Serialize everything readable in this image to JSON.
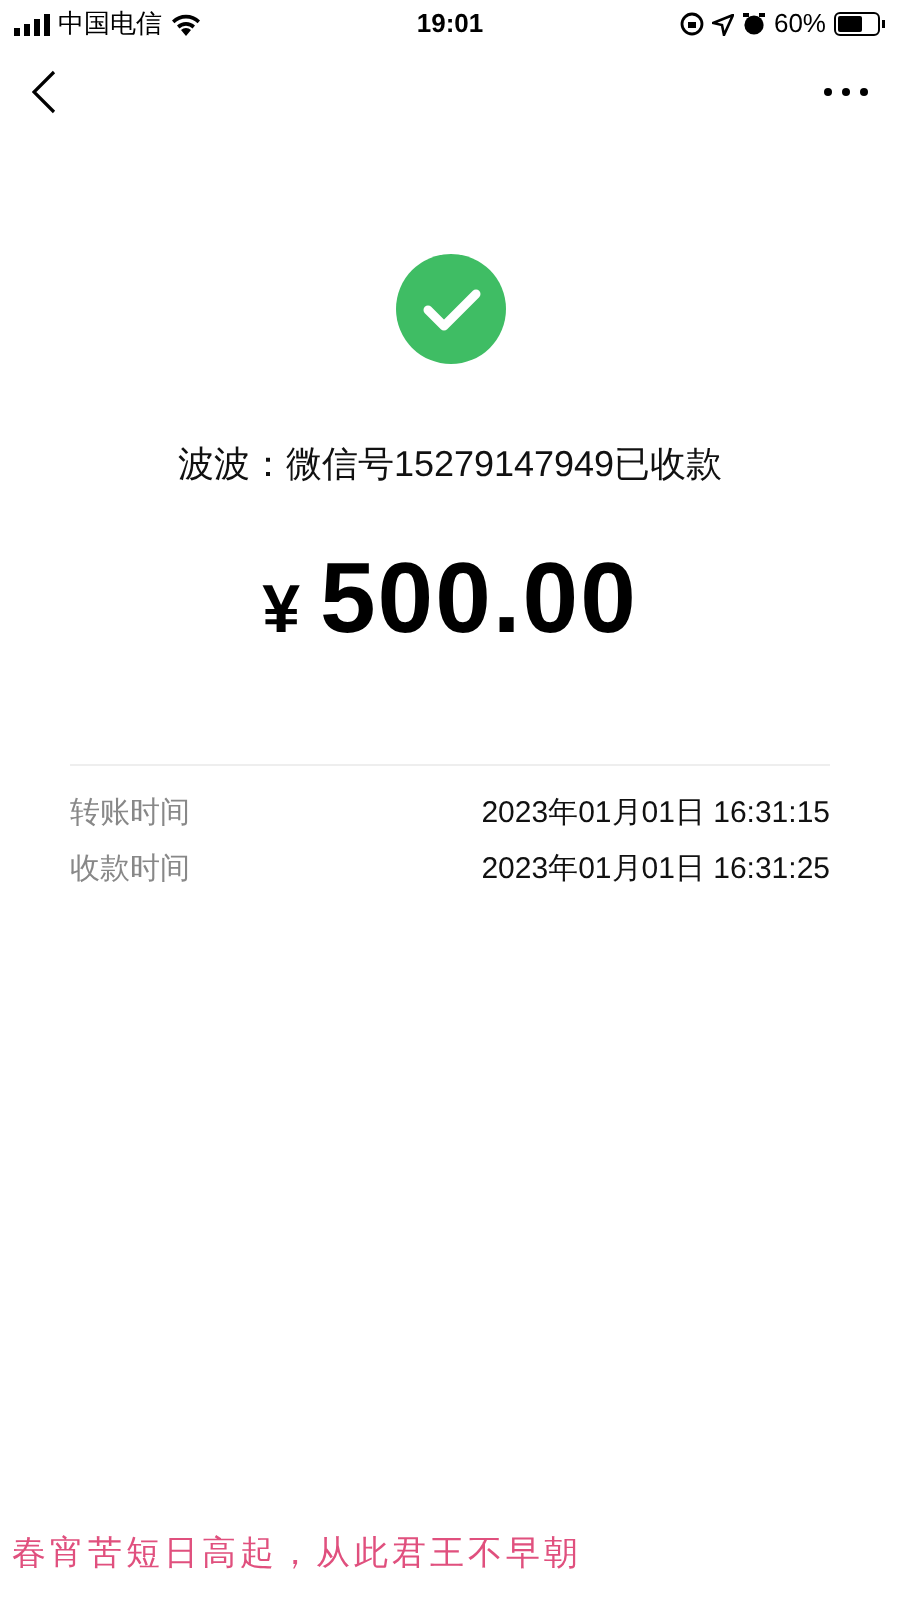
{
  "status_bar": {
    "carrier": "中国电信",
    "time": "19:01",
    "battery": "60%"
  },
  "receipt": {
    "payee": "波波：微信号15279147949已收款",
    "currency": "¥",
    "amount": "500.00"
  },
  "details": [
    {
      "label": "转账时间",
      "value": "2023年01月01日 16:31:15"
    },
    {
      "label": "收款时间",
      "value": "2023年01月01日 16:31:25"
    }
  ],
  "caption": "春宵苦短日高起，从此君王不早朝"
}
